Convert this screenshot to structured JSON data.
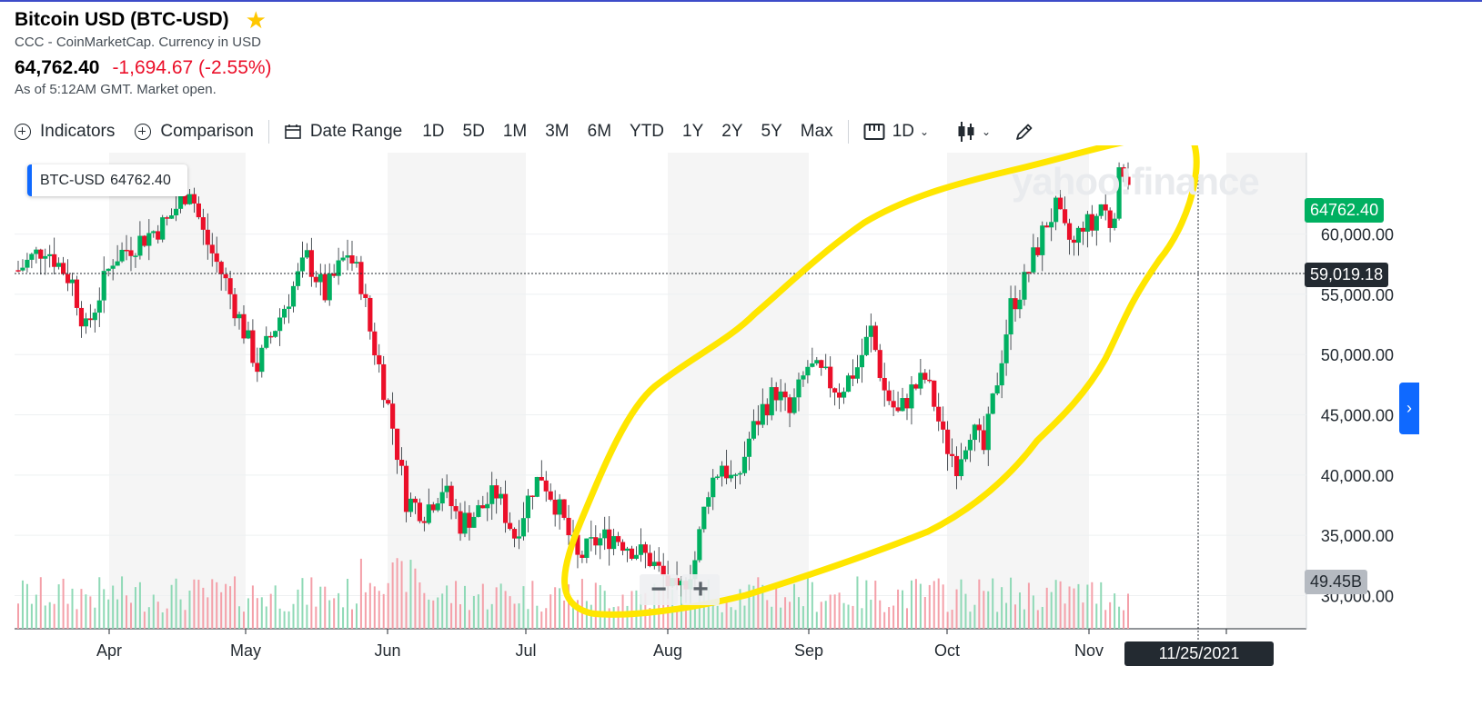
{
  "header": {
    "title": "Bitcoin USD (BTC-USD)",
    "subtitle": "CCC - CoinMarketCap. Currency in USD",
    "price": "64,762.40",
    "change": "-1,694.67 (-2.55%)",
    "as_of": "As of 5:12AM GMT. Market open."
  },
  "toolbar": {
    "indicators": "Indicators",
    "comparison": "Comparison",
    "date_range": "Date Range",
    "ranges": [
      "1D",
      "5D",
      "1M",
      "3M",
      "6M",
      "YTD",
      "1Y",
      "2Y",
      "5Y",
      "Max"
    ],
    "interval": "1D"
  },
  "legend": {
    "symbol": "BTC-USD",
    "value": "64762.40"
  },
  "watermark": "yahoo!finance",
  "tags": {
    "last_price": "64762.40",
    "crosshair_price": "59,019.18",
    "volume": "49.45B",
    "crosshair_date": "11/25/2021"
  },
  "zoom": {
    "minus": "−",
    "plus": "+"
  },
  "colors": {
    "up": "#00b061",
    "down": "#eb0f29",
    "annotation": "#ffe600",
    "accent": "#0f69ff"
  },
  "chart_data": {
    "type": "candlestick",
    "x_labels": [
      "Apr",
      "May",
      "Jun",
      "Jul",
      "Aug",
      "Sep",
      "Oct",
      "Nov"
    ],
    "y_ticks": [
      "30,000.00",
      "35,000.00",
      "40,000.00",
      "45,000.00",
      "50,000.00",
      "55,000.00",
      "60,000.00"
    ],
    "ylim": [
      28000,
      66000
    ],
    "close_path": [
      [
        57000,
        0
      ],
      [
        59000,
        12
      ],
      [
        56000,
        24
      ],
      [
        52000,
        30
      ],
      [
        58000,
        42
      ],
      [
        59500,
        54
      ],
      [
        61000,
        66
      ],
      [
        64000,
        76
      ],
      [
        60000,
        82
      ],
      [
        56000,
        92
      ],
      [
        52000,
        100
      ],
      [
        49000,
        106
      ],
      [
        54000,
        118
      ],
      [
        58000,
        128
      ],
      [
        55000,
        136
      ],
      [
        58500,
        146
      ],
      [
        56000,
        152
      ],
      [
        52000,
        156
      ],
      [
        49000,
        160
      ],
      [
        44000,
        166
      ],
      [
        38000,
        172
      ],
      [
        37000,
        180
      ],
      [
        39000,
        188
      ],
      [
        36000,
        196
      ],
      [
        37000,
        204
      ],
      [
        38500,
        212
      ],
      [
        35000,
        220
      ],
      [
        39000,
        228
      ],
      [
        40000,
        232
      ],
      [
        37000,
        240
      ],
      [
        33000,
        248
      ],
      [
        34500,
        256
      ],
      [
        35000,
        264
      ],
      [
        34000,
        272
      ],
      [
        33000,
        280
      ],
      [
        31000,
        288
      ],
      [
        29800,
        292
      ],
      [
        33000,
        300
      ],
      [
        39000,
        306
      ],
      [
        41000,
        312
      ],
      [
        39000,
        318
      ],
      [
        43000,
        324
      ],
      [
        45500,
        330
      ],
      [
        47000,
        336
      ],
      [
        45000,
        342
      ],
      [
        49000,
        350
      ],
      [
        48000,
        358
      ],
      [
        47000,
        364
      ],
      [
        49000,
        372
      ],
      [
        52000,
        378
      ],
      [
        47000,
        384
      ],
      [
        45000,
        390
      ],
      [
        47000,
        396
      ],
      [
        48000,
        402
      ],
      [
        46000,
        406
      ],
      [
        43000,
        410
      ],
      [
        41000,
        416
      ],
      [
        44000,
        422
      ],
      [
        42000,
        428
      ],
      [
        48000,
        434
      ],
      [
        54000,
        440
      ],
      [
        56000,
        446
      ],
      [
        58000,
        450
      ],
      [
        61000,
        456
      ],
      [
        62000,
        460
      ],
      [
        60000,
        464
      ],
      [
        59000,
        468
      ],
      [
        61000,
        472
      ],
      [
        60500,
        476
      ],
      [
        62500,
        480
      ],
      [
        61000,
        484
      ],
      [
        63000,
        487
      ],
      [
        66000,
        489
      ],
      [
        64762,
        492
      ]
    ],
    "volume_label": "49.45B"
  }
}
